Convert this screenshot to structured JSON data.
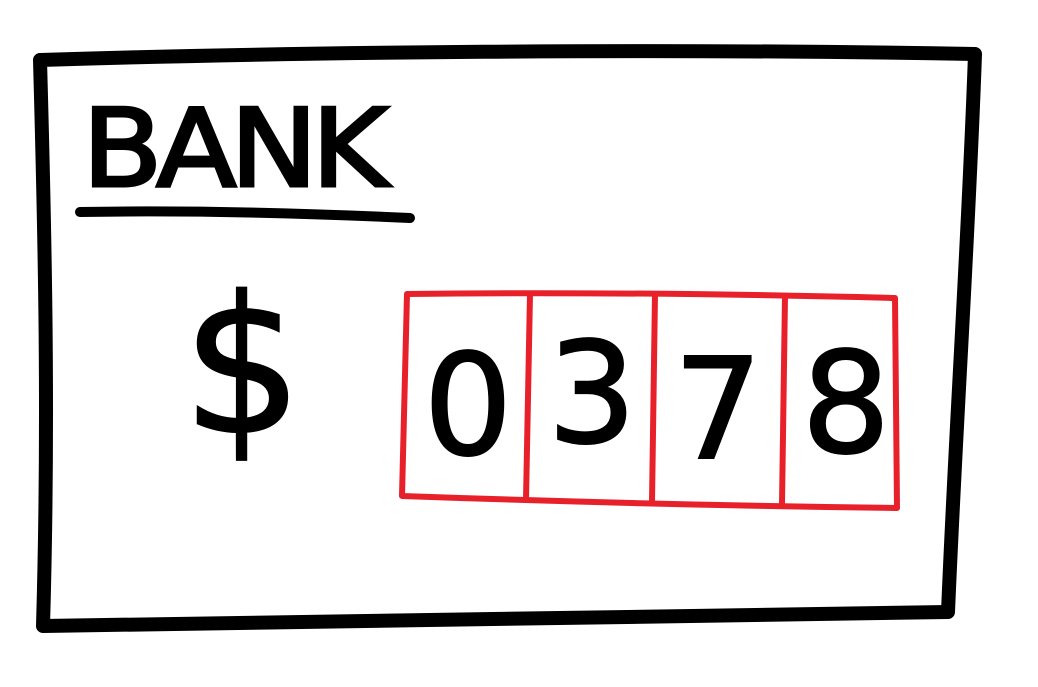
{
  "card": {
    "title": "BANK",
    "currency_symbol": "$",
    "balance_digits": [
      "0",
      "3",
      "7",
      "8"
    ]
  },
  "colors": {
    "ink": "#000000",
    "digit_box": "#e8202a",
    "background": "#ffffff"
  }
}
